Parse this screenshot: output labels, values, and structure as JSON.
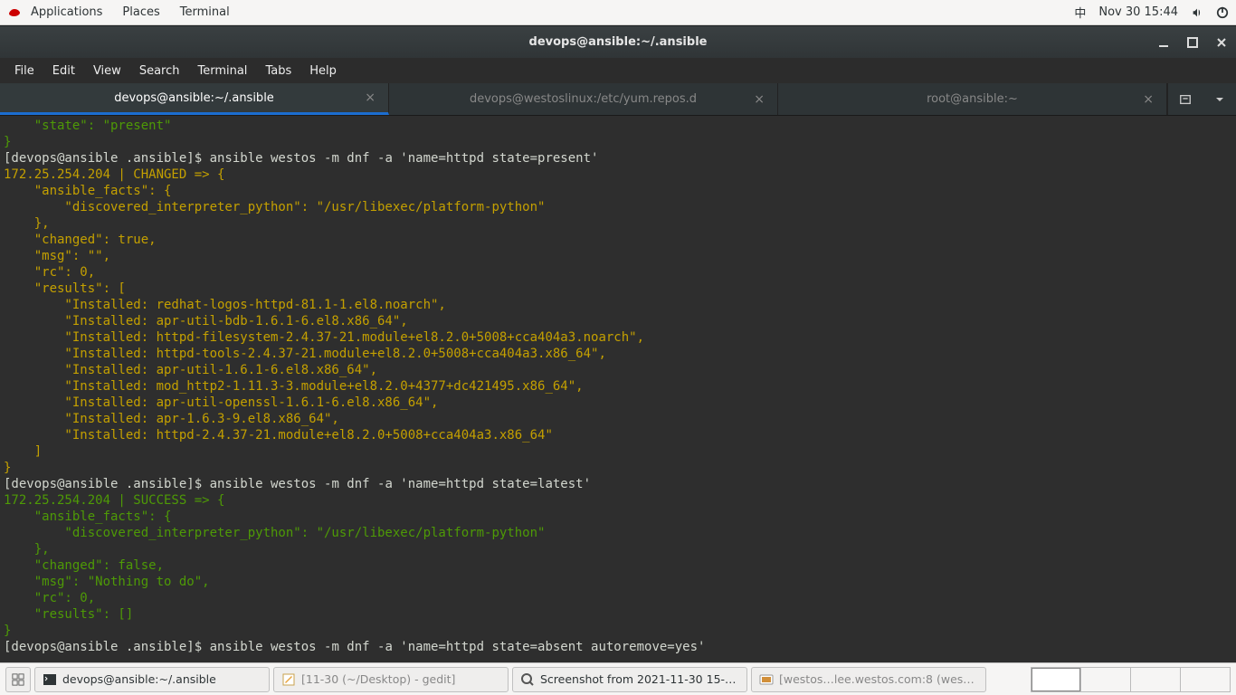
{
  "top_panel": {
    "apps": "Applications",
    "places": "Places",
    "terminal": "Terminal",
    "ime": "中",
    "clock": "Nov 30  15:44"
  },
  "titlebar": {
    "title": "devops@ansible:~/.ansible"
  },
  "menubar": {
    "file": "File",
    "edit": "Edit",
    "view": "View",
    "search": "Search",
    "terminal": "Terminal",
    "tabs": "Tabs",
    "help": "Help"
  },
  "tabs": [
    {
      "label": "devops@ansible:~/.ansible",
      "active": true
    },
    {
      "label": "devops@westoslinux:/etc/yum.repos.d",
      "active": false
    },
    {
      "label": "root@ansible:~",
      "active": false
    }
  ],
  "term": {
    "l0": "    \"state\": \"present\"",
    "l1": "}",
    "l2p": "[devops@ansible .ansible]$ ",
    "l2c": "ansible westos -m dnf -a 'name=httpd state=present'",
    "l3": "172.25.254.204 | CHANGED => {",
    "l4": "    \"ansible_facts\": {",
    "l5": "        \"discovered_interpreter_python\": \"/usr/libexec/platform-python\"",
    "l6": "    },",
    "l7": "    \"changed\": true,",
    "l8": "    \"msg\": \"\",",
    "l9": "    \"rc\": 0,",
    "l10": "    \"results\": [",
    "l11": "        \"Installed: redhat-logos-httpd-81.1-1.el8.noarch\",",
    "l12": "        \"Installed: apr-util-bdb-1.6.1-6.el8.x86_64\",",
    "l13": "        \"Installed: httpd-filesystem-2.4.37-21.module+el8.2.0+5008+cca404a3.noarch\",",
    "l14": "        \"Installed: httpd-tools-2.4.37-21.module+el8.2.0+5008+cca404a3.x86_64\",",
    "l15": "        \"Installed: apr-util-1.6.1-6.el8.x86_64\",",
    "l16": "        \"Installed: mod_http2-1.11.3-3.module+el8.2.0+4377+dc421495.x86_64\",",
    "l17": "        \"Installed: apr-util-openssl-1.6.1-6.el8.x86_64\",",
    "l18": "        \"Installed: apr-1.6.3-9.el8.x86_64\",",
    "l19": "        \"Installed: httpd-2.4.37-21.module+el8.2.0+5008+cca404a3.x86_64\"",
    "l20": "    ]",
    "l21": "}",
    "l22p": "[devops@ansible .ansible]$ ",
    "l22c": "ansible westos -m dnf -a 'name=httpd state=latest'",
    "l23": "172.25.254.204 | SUCCESS => {",
    "l24": "    \"ansible_facts\": {",
    "l25": "        \"discovered_interpreter_python\": \"/usr/libexec/platform-python\"",
    "l26": "    },",
    "l27": "    \"changed\": false,",
    "l28": "    \"msg\": \"Nothing to do\",",
    "l29": "    \"rc\": 0,",
    "l30": "    \"results\": []",
    "l31": "}",
    "l32p": "[devops@ansible .ansible]$ ",
    "l32c": "ansible westos -m dnf -a 'name=httpd state=absent autoremove=yes'"
  },
  "taskbar": {
    "t1": "devops@ansible:~/.ansible",
    "t2": "[11-30 (~/Desktop) - gedit]",
    "t3": "Screenshot from 2021-11-30 15-3…",
    "t4": "[westos…lee.westos.com:8 (westos)…"
  }
}
